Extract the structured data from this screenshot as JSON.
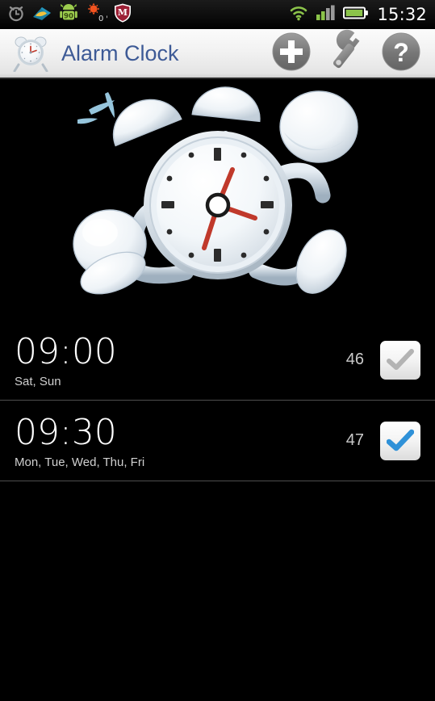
{
  "status_bar": {
    "left_icons": [
      {
        "name": "alarm-set-icon",
        "label": "alarm"
      },
      {
        "name": "maps-navigation-icon",
        "label": "navigation"
      },
      {
        "name": "android-battery-icon",
        "label": "90"
      },
      {
        "name": "sun-brightness-icon",
        "label": "0 %"
      },
      {
        "name": "mcafee-security-icon",
        "label": "M"
      }
    ],
    "right_icons": [
      {
        "name": "wifi-icon",
        "label": "wifi"
      },
      {
        "name": "cellular-signal-icon",
        "label": "signal"
      },
      {
        "name": "battery-icon",
        "label": "battery"
      }
    ],
    "android_badge": "90",
    "brightness_badge": "0 %",
    "shield_letter": "M",
    "time": "15:32"
  },
  "title_bar": {
    "icon": "alarm-clock-icon",
    "title": "Alarm Clock",
    "buttons": [
      {
        "name": "add-alarm-button",
        "icon": "plus-icon",
        "label": "+"
      },
      {
        "name": "settings-button",
        "icon": "wrench-icon",
        "label": ""
      },
      {
        "name": "help-button",
        "icon": "question-mark-icon",
        "label": "?"
      }
    ],
    "title_color": "#3d5a96",
    "help_glyph": "?"
  },
  "hero": {
    "name": "running-alarm-clock-illustration",
    "description": "Cartoon alarm clock running"
  },
  "alarms": [
    {
      "time": "09:00",
      "days": "Sat, Sun",
      "index": "46",
      "enabled": false,
      "check_color": "#a8a8a8"
    },
    {
      "time": "09:30",
      "days": "Mon, Tue, Wed, Thu, Fri",
      "index": "47",
      "enabled": true,
      "check_color": "#2f91d8"
    }
  ],
  "colors": {
    "background": "#000000",
    "title_bar_bg": "#f2f2f2",
    "accent_blue": "#2f91d8",
    "divider": "#4e4e4e",
    "status_green": "#8bc34a"
  }
}
